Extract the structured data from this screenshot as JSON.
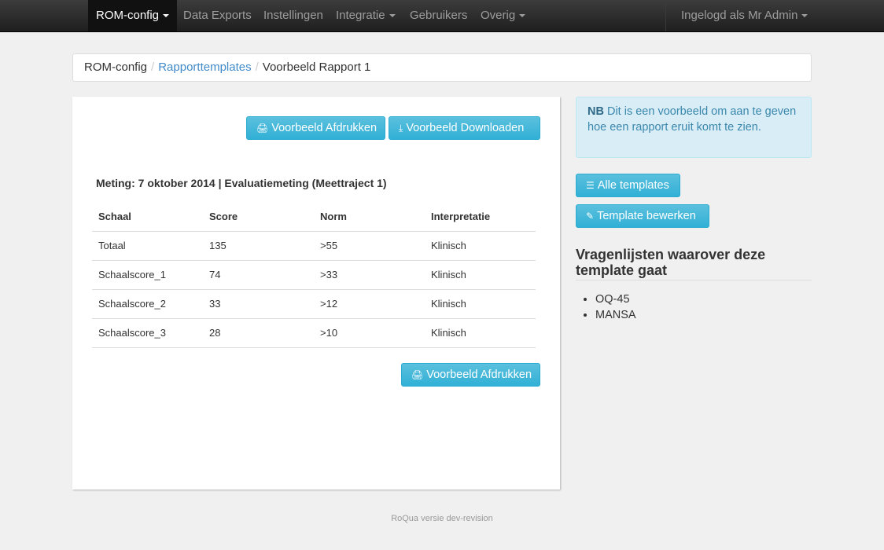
{
  "navbar": {
    "brand": "ROM-config",
    "items": [
      {
        "label": "Data Exports"
      },
      {
        "label": "Instellingen"
      },
      {
        "label": "Integratie"
      },
      {
        "label": "Gebruikers"
      },
      {
        "label": "Overig"
      }
    ],
    "user": "Ingelogd als Mr Admin"
  },
  "breadcrumb": {
    "root": "ROM-config",
    "link": "Rapporttemplates",
    "current": "Voorbeeld Rapport 1",
    "separator": "/"
  },
  "panel": {
    "print_label": "Voorbeeld Afdrukken",
    "download_label": "Voorbeeld Downloaden",
    "meting": "Meting: 7 oktober 2014 | Evaluatiemeting (Meettraject 1)",
    "table": {
      "headers": [
        "Schaal",
        "Score",
        "Norm",
        "Interpretatie"
      ],
      "rows": [
        [
          "Totaal",
          "135",
          ">55",
          "Klinisch"
        ],
        [
          "Schaalscore_1",
          "74",
          ">33",
          "Klinisch"
        ],
        [
          "Schaalscore_2",
          "33",
          ">12",
          "Klinisch"
        ],
        [
          "Schaalscore_3",
          "28",
          ">10",
          "Klinisch"
        ]
      ]
    },
    "print_bottom_label": "Voorbeeld Afdrukken"
  },
  "sidebar": {
    "alert_bold": "NB",
    "alert_text": "Dit is een voorbeeld om aan te geven hoe een rapport eruit komt te zien.",
    "all_templates_label": "Alle templates",
    "edit_template_label": "Template bewerken",
    "questionnaires_title": "Vragenlijsten waarover deze template gaat",
    "questionnaires": [
      "OQ-45",
      "MANSA"
    ]
  },
  "footer": "RoQua versie dev-revision",
  "colors": {
    "navbar_bg": "#222222",
    "button_info": "#39b3d7",
    "link": "#428bca",
    "alert_bg": "#d9edf7",
    "alert_text": "#3a87ad"
  },
  "icons": {
    "print": "print-icon",
    "download": "download-circle-icon",
    "list": "list-icon",
    "edit": "edit-icon"
  }
}
